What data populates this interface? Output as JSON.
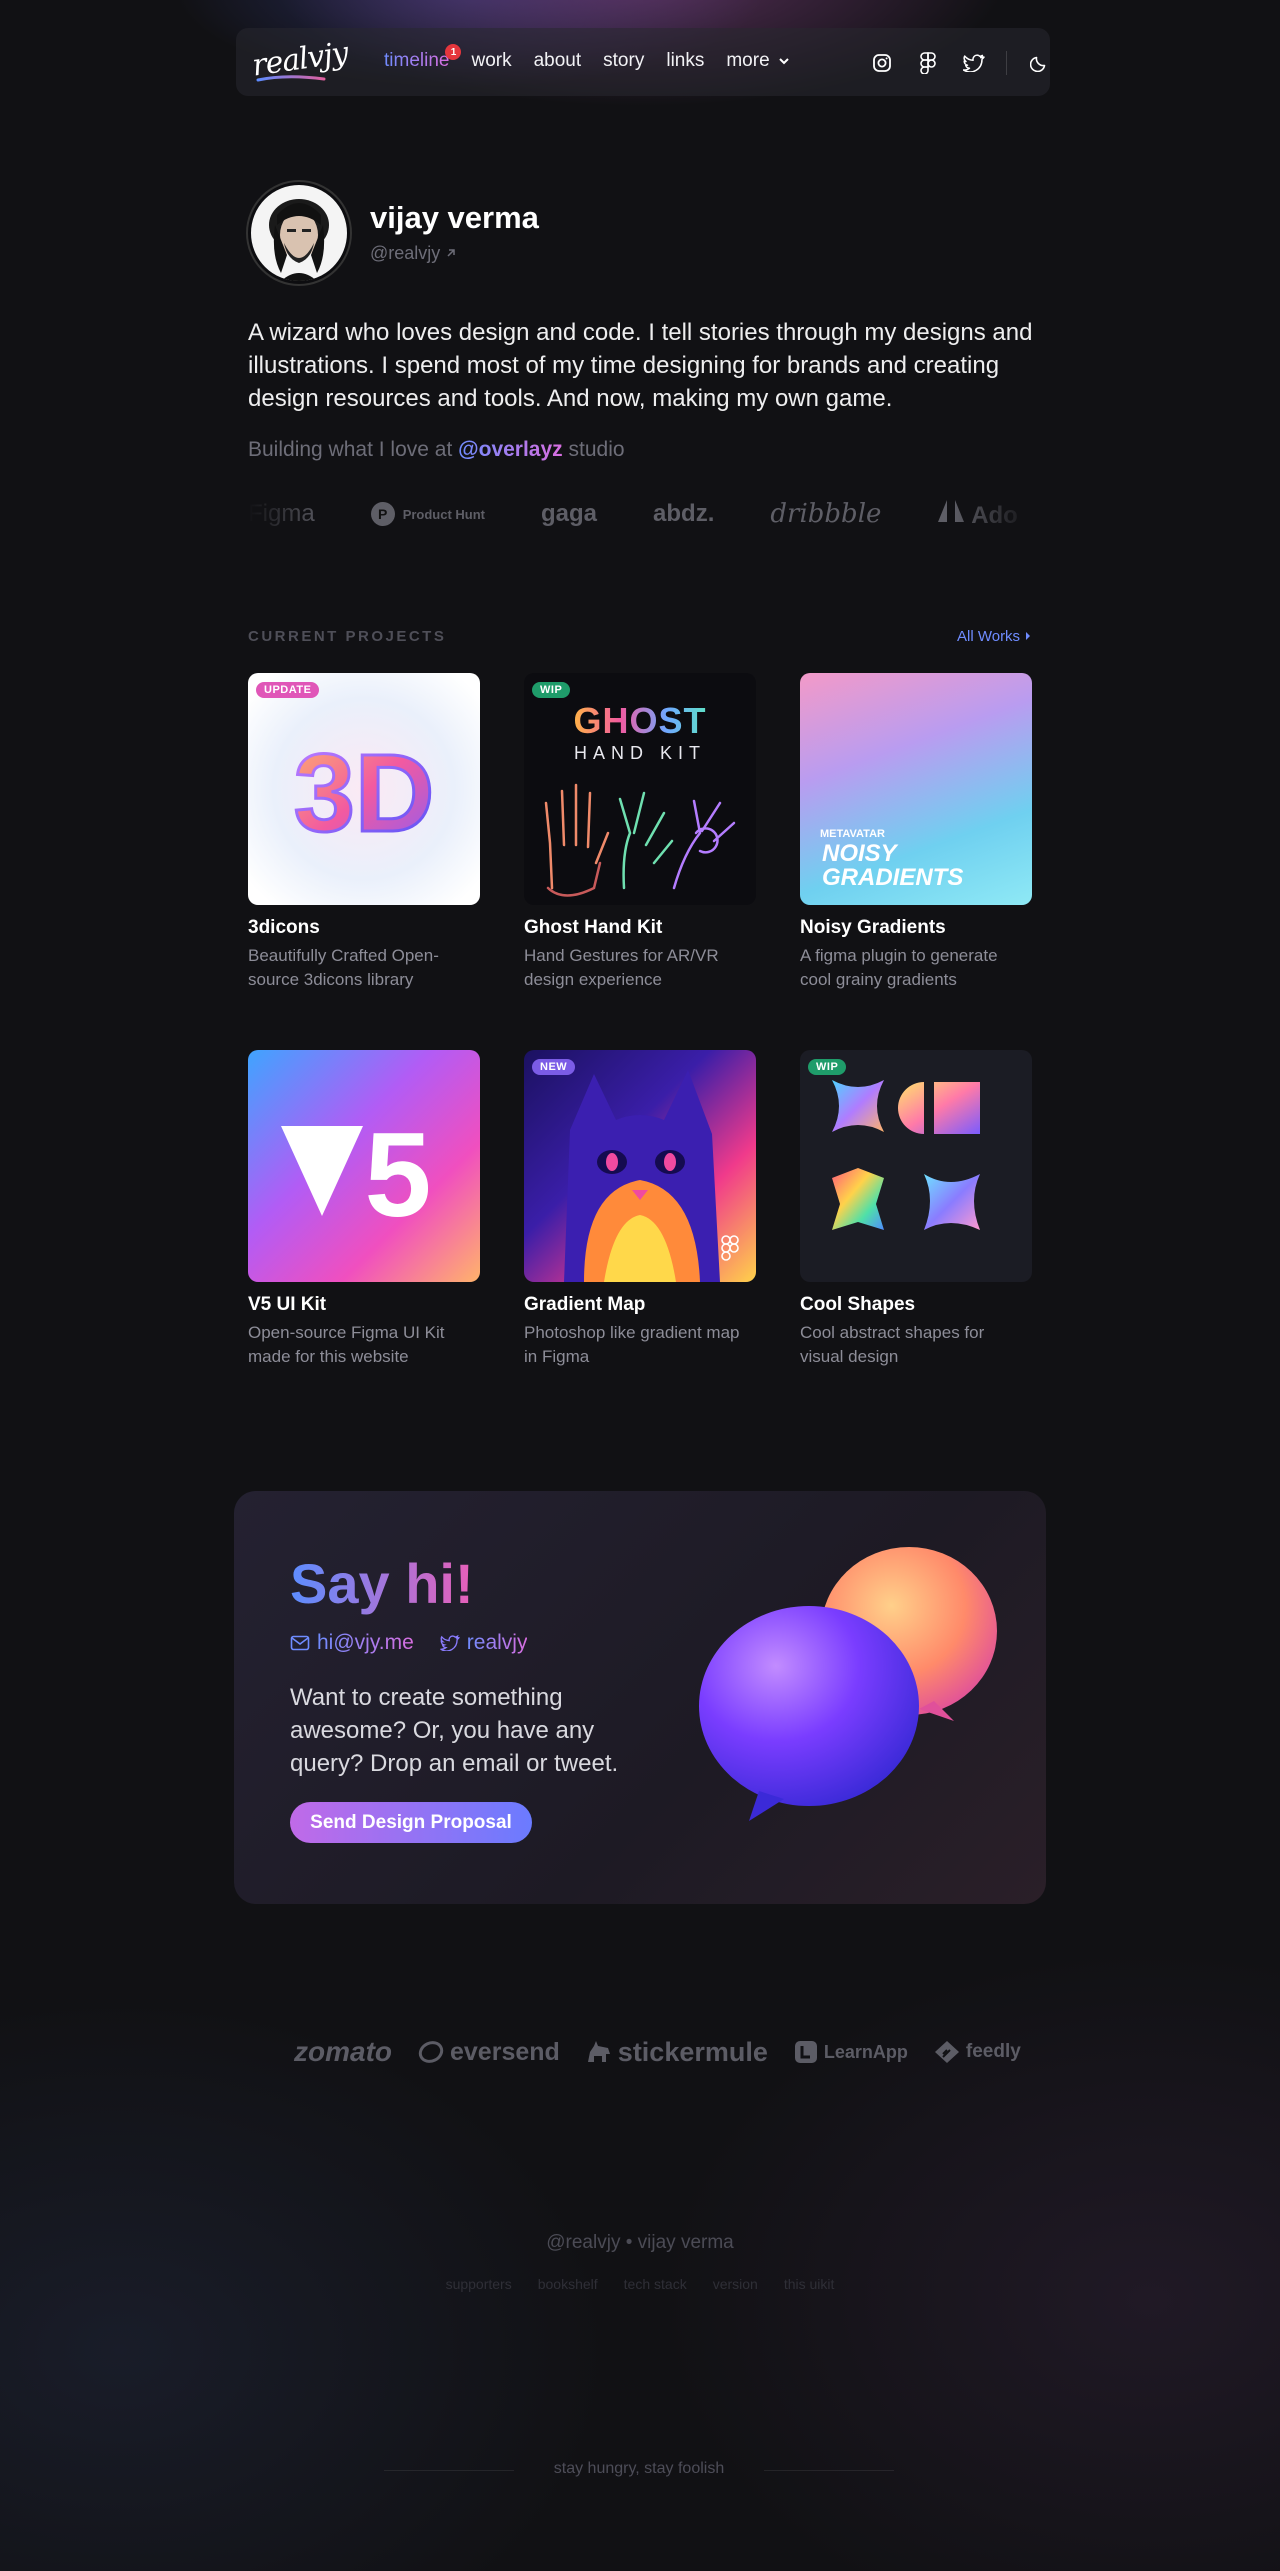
{
  "nav": {
    "logo_text": "realvjy",
    "links": [
      {
        "label": "timeline",
        "badge": "1",
        "active": true
      },
      {
        "label": "work"
      },
      {
        "label": "about"
      },
      {
        "label": "story"
      },
      {
        "label": "links"
      },
      {
        "label": "more"
      }
    ],
    "icons": [
      "instagram-icon",
      "figma-icon",
      "twitter-icon",
      "moon-icon"
    ]
  },
  "profile": {
    "name": "vijay verma",
    "handle": "@realvjy",
    "bio": "A wizard who loves design and code. I tell stories through my designs and illustrations. I spend most of my time designing for brands and creating design resources and tools. And now, making my own game.",
    "building_prefix": "Building what I love at",
    "studio": "@overlayz",
    "building_suffix": "studio"
  },
  "clients": [
    "Figma",
    "Product Hunt",
    "gaga",
    "abdz.",
    "dribbble",
    "Ado"
  ],
  "projects": {
    "section_label": "CURRENT PROJECTS",
    "all_works": "All Works",
    "items": [
      {
        "title": "3dicons",
        "desc": "Beautifully Crafted Open-source 3dicons library",
        "tag": "UPDATE",
        "tag_color": "#e056b8",
        "art": "3D"
      },
      {
        "title": "Ghost Hand Kit",
        "desc": "Hand Gestures for AR/VR design experience",
        "tag": "WIP",
        "tag_color": "#1f9c6a",
        "art_title": "GHOST",
        "art_sub": "HAND KIT"
      },
      {
        "title": "Noisy Gradients",
        "desc": "A figma plugin to generate cool grainy gradients",
        "art_brand": "METAVATAR",
        "art_line1": "NOISY",
        "art_line2": "GRADIENTS"
      },
      {
        "title": "V5 UI Kit",
        "desc": "Open-source Figma UI Kit made for this website",
        "art": "5"
      },
      {
        "title": "Gradient Map",
        "desc": "Photoshop like gradient map in Figma",
        "tag": "NEW",
        "tag_color": "#7b5ce6"
      },
      {
        "title": "Cool Shapes",
        "desc": "Cool abstract shapes for visual design",
        "tag": "WIP",
        "tag_color": "#1f9c6a"
      }
    ]
  },
  "say_hi": {
    "title": "Say hi!",
    "email": "hi@vjy.me",
    "twitter": "realvjy",
    "text": "Want to create something awesome? Or, you have any query? Drop an email or tweet.",
    "button": "Send Design Proposal"
  },
  "brands": [
    "zomato",
    "eversend",
    "stickermule",
    "LearnApp",
    "feedly"
  ],
  "footer": {
    "main": "@realvjy • vijay verma",
    "links": [
      "supporters",
      "bookshelf",
      "tech stack",
      "version",
      "this uikit"
    ],
    "motto": "stay hungry, stay foolish"
  },
  "colors": {
    "accent_blue": "#6f8cff",
    "accent_pink": "#d96ee0",
    "background": "#111114"
  }
}
